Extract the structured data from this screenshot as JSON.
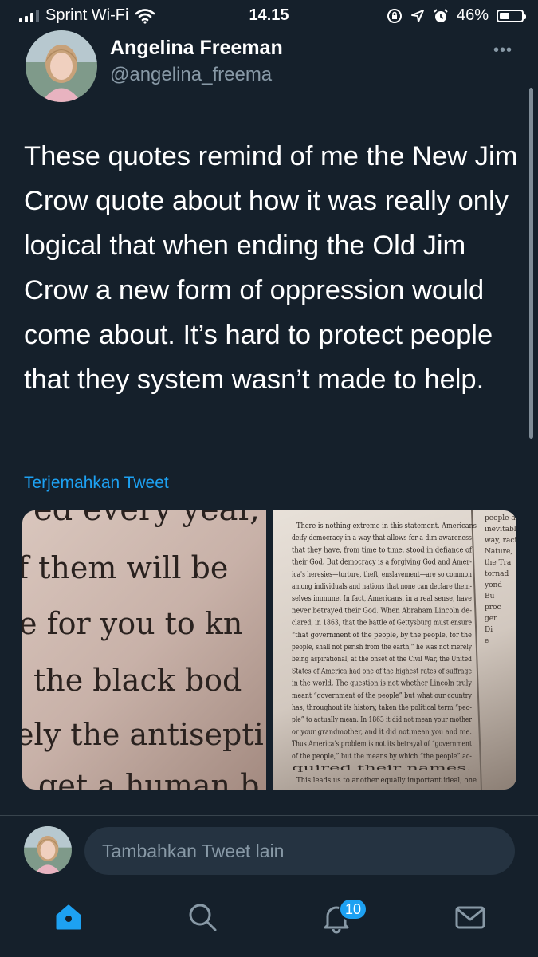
{
  "status_bar": {
    "carrier": "Sprint Wi-Fi",
    "time": "14.15",
    "battery": "46%",
    "battery_level": 0.46
  },
  "tweet": {
    "author_name": "Angelina Freeman",
    "author_handle": "@angelina_freema",
    "text": "These quotes remind of me the New Jim Crow quote about how it was really only logical that when ending the Old Jim Crow a new form of oppression would come about. It’s hard to protect people that they system wasn’t made to help.",
    "translate_label": "Terjemahkan Tweet",
    "media": [
      {
        "lines": [
          "ed every year,",
          "f them will be",
          "e for you to kn",
          "the black bod",
          "ely the antisepti",
          "get a human b"
        ]
      },
      {
        "lines": [
          "There is nothing extreme in this statement. Americans",
          "deify democracy in a way that allows for a dim awareness",
          "that they have, from time to time, stood in defiance of",
          "their God. But democracy is a forgiving God and Amer-",
          "ica's heresies—torture, theft, enslavement—are so common",
          "among individuals and nations that none can declare them-",
          "selves immune. In fact, Americans, in a real sense, have",
          "never betrayed their God. When Abraham Lincoln de-",
          "clared, in 1863, that the battle of Gettysburg must ensure",
          "“that government of the people, by the people, for the",
          "people, shall not perish from the earth,” he was not merely",
          "being aspirational; at the onset of the Civil War, the United",
          "States of America had one of the highest rates of suffrage",
          "in the world. The question is not whether Lincoln truly",
          "meant “government of the people” but what our country",
          "has, throughout its history, taken the political term “peo-",
          "ple” to actually mean. In 1863 it did not mean your mother",
          "or your grandmother, and it did not mean you and me.",
          "Thus America's problem is not its betrayal of “government",
          "of the people,” but the means by which “the people” ac-",
          "quired their names.",
          "This leads us to another equally important ideal, one"
        ],
        "side_lines": [
          "people a",
          "inevitably",
          "way, racis",
          "Nature,",
          "the Tra",
          "tornad",
          "yond",
          "Bu",
          "proc",
          "gen",
          "Di",
          "e"
        ]
      }
    ]
  },
  "reply": {
    "placeholder": "Tambahkan Tweet lain"
  },
  "tab_bar": {
    "notifications_count": "10",
    "tabs": [
      "home-icon",
      "search-icon",
      "bell-icon",
      "mail-icon"
    ]
  },
  "colors": {
    "background": "#15202b",
    "accent": "#1da1f2",
    "secondary_text": "#8899a6",
    "input_background": "#253341"
  }
}
